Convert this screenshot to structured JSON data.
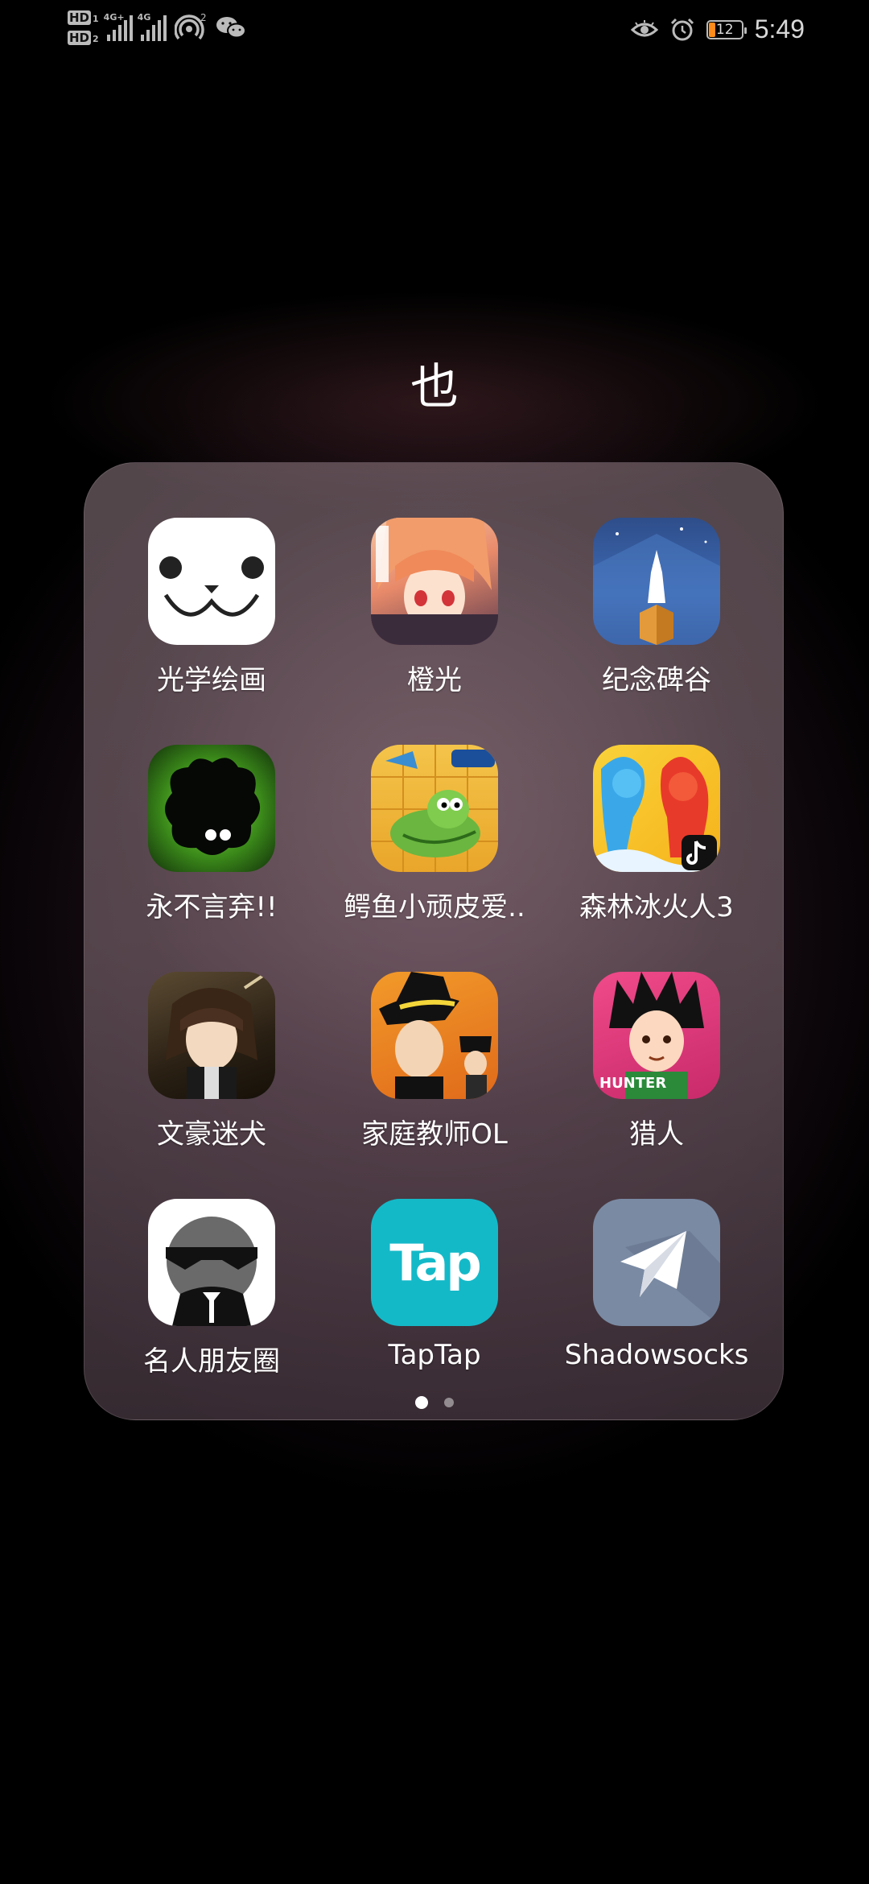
{
  "status_bar": {
    "hd1": "HD",
    "hd2": "HD",
    "hd1_sub": "1",
    "hd2_sub": "2",
    "net1": "4G+",
    "net2": "4G",
    "hotspot_count": "2",
    "battery": "12",
    "time": "5:49"
  },
  "folder": {
    "title": "也",
    "apps": [
      {
        "label": "光学绘画",
        "icon": "bear-face-icon"
      },
      {
        "label": "橙光",
        "icon": "anime-girl-icon"
      },
      {
        "label": "纪念碑谷",
        "icon": "monument-valley-icon"
      },
      {
        "label": "永不言弃!!",
        "icon": "black-blob-icon"
      },
      {
        "label": "鳄鱼小顽皮爱..",
        "icon": "crocodile-icon"
      },
      {
        "label": "森林冰火人3",
        "icon": "fireboy-watergirl-icon"
      },
      {
        "label": "文豪迷犬",
        "icon": "bungo-character-icon"
      },
      {
        "label": "家庭教师OL",
        "icon": "reborn-character-icon"
      },
      {
        "label": "猎人",
        "icon": "hunter-gon-icon"
      },
      {
        "label": "名人朋友圈",
        "icon": "sunglasses-man-icon"
      },
      {
        "label": "TapTap",
        "icon": "taptap-icon"
      },
      {
        "label": "Shadowsocks",
        "icon": "paper-plane-icon"
      }
    ],
    "taptap_logo": "Tap"
  },
  "page_indicator": {
    "current": 1,
    "total": 2
  }
}
